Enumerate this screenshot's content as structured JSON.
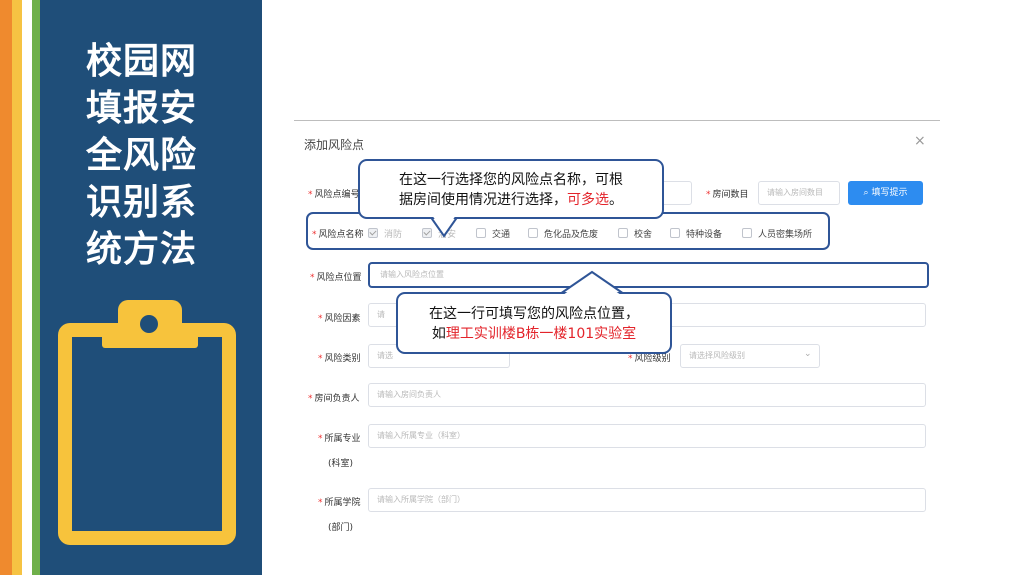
{
  "slide": {
    "title_lines": [
      "校园网",
      "填报安",
      "全风险",
      "识别系",
      "统方法"
    ]
  },
  "dialog": {
    "title": "添加风险点",
    "close": "×",
    "fields": {
      "code_label": "风险点编号",
      "room_count_label": "房间数目",
      "room_count_placeholder": "请输入房间数目",
      "hint_button": "填写提示",
      "name_label": "风险点名称",
      "position_label": "风险点位置",
      "position_placeholder": "请输入风险点位置",
      "factor_label": "风险因素",
      "factor_placeholder": "请",
      "category_label": "风险类别",
      "category_placeholder": "请选",
      "level_label": "风险级别",
      "level_placeholder": "请选择风险级别",
      "owner_label": "房间负责人",
      "owner_placeholder": "请输入房间负责人",
      "major_label": "所属专业",
      "major_label_sub": "(科室)",
      "major_placeholder": "请输入所属专业（科室）",
      "college_label": "所属学院",
      "college_label_sub": "(部门)",
      "college_placeholder": "请输入所属学院（部门）"
    },
    "required_mark": "*",
    "checkboxes": [
      {
        "label": "消防",
        "checked": true
      },
      {
        "label": "治安",
        "checked": true
      },
      {
        "label": "交通",
        "checked": false
      },
      {
        "label": "危化品及危废",
        "checked": false
      },
      {
        "label": "校舍",
        "checked": false
      },
      {
        "label": "特种设备",
        "checked": false
      },
      {
        "label": "人员密集场所",
        "checked": false
      }
    ]
  },
  "callouts": {
    "top_line1": "在这一行选择您的风险点名称，可根",
    "top_line2_prefix": "据房间使用情况进行选择，",
    "top_line2_red": "可多选",
    "top_line2_suffix": "。",
    "bottom_line1": "在这一行可填写您的风险点位置，",
    "bottom_line2_prefix": "如",
    "bottom_line2_red": "理工实训楼B栋一楼101实验室"
  },
  "colors": {
    "sidebar": "#1f4e79",
    "accent_yellow": "#f7c33c",
    "highlight_border": "#2f5597",
    "primary_button": "#2d8cf0",
    "emphasis_red": "#e3242b"
  },
  "icons": {
    "search": "search-icon",
    "chevron": "chevron-down-icon",
    "clipboard": "clipboard-icon"
  }
}
